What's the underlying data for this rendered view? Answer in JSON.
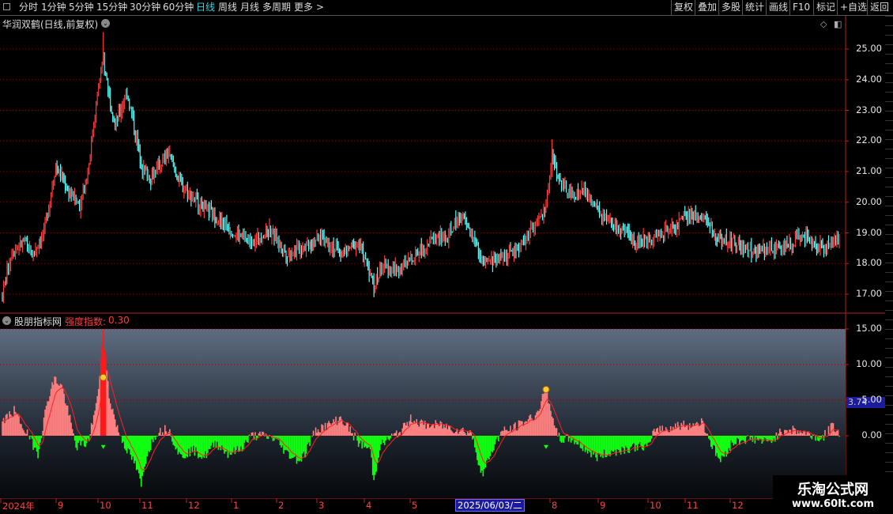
{
  "toolbar": {
    "left": [
      {
        "label": "分时",
        "active": false
      },
      {
        "label": "1分钟",
        "active": false
      },
      {
        "label": "5分钟",
        "active": false
      },
      {
        "label": "15分钟",
        "active": false
      },
      {
        "label": "30分钟",
        "active": false
      },
      {
        "label": "60分钟",
        "active": false
      },
      {
        "label": "日线",
        "active": true
      },
      {
        "label": "周线",
        "active": false
      },
      {
        "label": "月线",
        "active": false
      },
      {
        "label": "多周期",
        "active": false
      },
      {
        "label": "更多 >",
        "active": false
      }
    ],
    "right": [
      "复权",
      "叠加",
      "多股",
      "统计",
      "画线",
      "F10",
      "标记",
      "+自选",
      "返回"
    ]
  },
  "main_panel": {
    "title": "华润双鹤(日线,前复权)",
    "y_ticks": [
      "25.00",
      "24.00",
      "23.00",
      "22.00",
      "21.00",
      "20.00",
      "19.00",
      "18.00",
      "17.00"
    ]
  },
  "sub_panel": {
    "name": "股朋指标网",
    "indicator_label": "强度指数:",
    "indicator_value": "0.30",
    "y_ticks": [
      "15.00",
      "10.00",
      "5.00",
      "0.00"
    ],
    "current_value": "3.74"
  },
  "x_axis": {
    "labels": [
      "2024年",
      "9",
      "10",
      "11",
      "12",
      "1",
      "2",
      "3",
      "4",
      "5",
      "8",
      "9",
      "10",
      "11",
      "12"
    ],
    "cursor_date": "2025/06/03/二"
  },
  "watermark": {
    "title": "乐淘公式网",
    "url": "www.60lt.com"
  },
  "colors": {
    "up": "#ff3b3b",
    "down": "#54ffff",
    "hist_up": "#ff8080",
    "hist_down": "#11ff11",
    "grid": "#7a0000",
    "accent": "#29d9e6"
  },
  "chart_data": [
    {
      "type": "candlestick",
      "title": "华润双鹤(日线,前复权)",
      "ylim": [
        16.7,
        25.6
      ],
      "anchors": [
        [
          0,
          17.0
        ],
        [
          8,
          18.4
        ],
        [
          18,
          18.7
        ],
        [
          25,
          18.3
        ],
        [
          35,
          19.0
        ],
        [
          45,
          21.2
        ],
        [
          55,
          20.4
        ],
        [
          65,
          19.9
        ],
        [
          72,
          21.0
        ],
        [
          80,
          23.5
        ],
        [
          85,
          24.6
        ],
        [
          95,
          22.5
        ],
        [
          105,
          23.6
        ],
        [
          118,
          21.1
        ],
        [
          125,
          20.8
        ],
        [
          140,
          21.6
        ],
        [
          150,
          20.6
        ],
        [
          165,
          20.0
        ],
        [
          180,
          19.5
        ],
        [
          195,
          19.0
        ],
        [
          210,
          18.7
        ],
        [
          225,
          19.1
        ],
        [
          240,
          18.3
        ],
        [
          255,
          18.6
        ],
        [
          270,
          18.9
        ],
        [
          285,
          18.3
        ],
        [
          300,
          18.7
        ],
        [
          313,
          17.3
        ],
        [
          320,
          17.9
        ],
        [
          335,
          17.8
        ],
        [
          350,
          18.4
        ],
        [
          365,
          18.9
        ],
        [
          375,
          18.8
        ],
        [
          385,
          19.6
        ],
        [
          395,
          19.0
        ],
        [
          405,
          18.0
        ],
        [
          420,
          18.2
        ],
        [
          435,
          18.5
        ],
        [
          450,
          19.3
        ],
        [
          458,
          19.8
        ],
        [
          463,
          21.6
        ],
        [
          470,
          20.6
        ],
        [
          480,
          20.2
        ],
        [
          490,
          20.4
        ],
        [
          505,
          19.5
        ],
        [
          520,
          19.1
        ],
        [
          535,
          18.7
        ],
        [
          550,
          18.9
        ],
        [
          565,
          19.2
        ],
        [
          575,
          19.5
        ],
        [
          590,
          19.6
        ],
        [
          600,
          18.9
        ],
        [
          615,
          18.7
        ],
        [
          630,
          18.4
        ],
        [
          645,
          18.4
        ],
        [
          660,
          18.6
        ],
        [
          675,
          18.9
        ],
        [
          690,
          18.5
        ],
        [
          705,
          18.8
        ]
      ]
    },
    {
      "type": "bar",
      "title": "强度指数",
      "ylim": [
        -9,
        15.5
      ],
      "reference_line": 0,
      "anchors": [
        [
          0,
          2
        ],
        [
          10,
          3.5
        ],
        [
          20,
          0.5
        ],
        [
          30,
          -2.5
        ],
        [
          38,
          5
        ],
        [
          44,
          8
        ],
        [
          50,
          7
        ],
        [
          56,
          3
        ],
        [
          62,
          -1.5
        ],
        [
          72,
          -1
        ],
        [
          80,
          5
        ],
        [
          85,
          14.5
        ],
        [
          90,
          5.5
        ],
        [
          97,
          1
        ],
        [
          105,
          -2
        ],
        [
          112,
          -4
        ],
        [
          117,
          -7
        ],
        [
          122,
          -2.5
        ],
        [
          130,
          0.5
        ],
        [
          140,
          1
        ],
        [
          150,
          -3
        ],
        [
          160,
          -2
        ],
        [
          170,
          -3
        ],
        [
          180,
          -1
        ],
        [
          190,
          -2.5
        ],
        [
          200,
          -2
        ],
        [
          210,
          0
        ],
        [
          220,
          0
        ],
        [
          230,
          -0.5
        ],
        [
          240,
          -2.5
        ],
        [
          250,
          -3.5
        ],
        [
          255,
          -2.5
        ],
        [
          260,
          -0.5
        ],
        [
          265,
          1
        ],
        [
          275,
          1.5
        ],
        [
          285,
          2.5
        ],
        [
          290,
          1.5
        ],
        [
          300,
          -1
        ],
        [
          310,
          -2
        ],
        [
          313,
          -6.5
        ],
        [
          318,
          -1.5
        ],
        [
          325,
          -0.5
        ],
        [
          335,
          0.5
        ],
        [
          345,
          2.5
        ],
        [
          355,
          1.5
        ],
        [
          370,
          1.5
        ],
        [
          380,
          1
        ],
        [
          395,
          0.5
        ],
        [
          400,
          -3
        ],
        [
          405,
          -5.5
        ],
        [
          410,
          -3
        ],
        [
          420,
          0.5
        ],
        [
          430,
          1
        ],
        [
          440,
          2
        ],
        [
          450,
          3
        ],
        [
          458,
          6.5
        ],
        [
          462,
          4
        ],
        [
          465,
          1
        ],
        [
          470,
          -0.5
        ],
        [
          480,
          -0.5
        ],
        [
          500,
          -3
        ],
        [
          510,
          -2.5
        ],
        [
          520,
          -2
        ],
        [
          535,
          -1.5
        ],
        [
          545,
          -1.5
        ],
        [
          550,
          1
        ],
        [
          560,
          1
        ],
        [
          570,
          1.5
        ],
        [
          580,
          1.5
        ],
        [
          590,
          2
        ],
        [
          598,
          -1.5
        ],
        [
          605,
          -3.5
        ],
        [
          615,
          -1
        ],
        [
          625,
          -0.5
        ],
        [
          635,
          -0.5
        ],
        [
          645,
          -1
        ],
        [
          660,
          1
        ],
        [
          675,
          0.5
        ],
        [
          690,
          -0.5
        ],
        [
          700,
          1.5
        ],
        [
          705,
          0.3
        ]
      ]
    }
  ]
}
